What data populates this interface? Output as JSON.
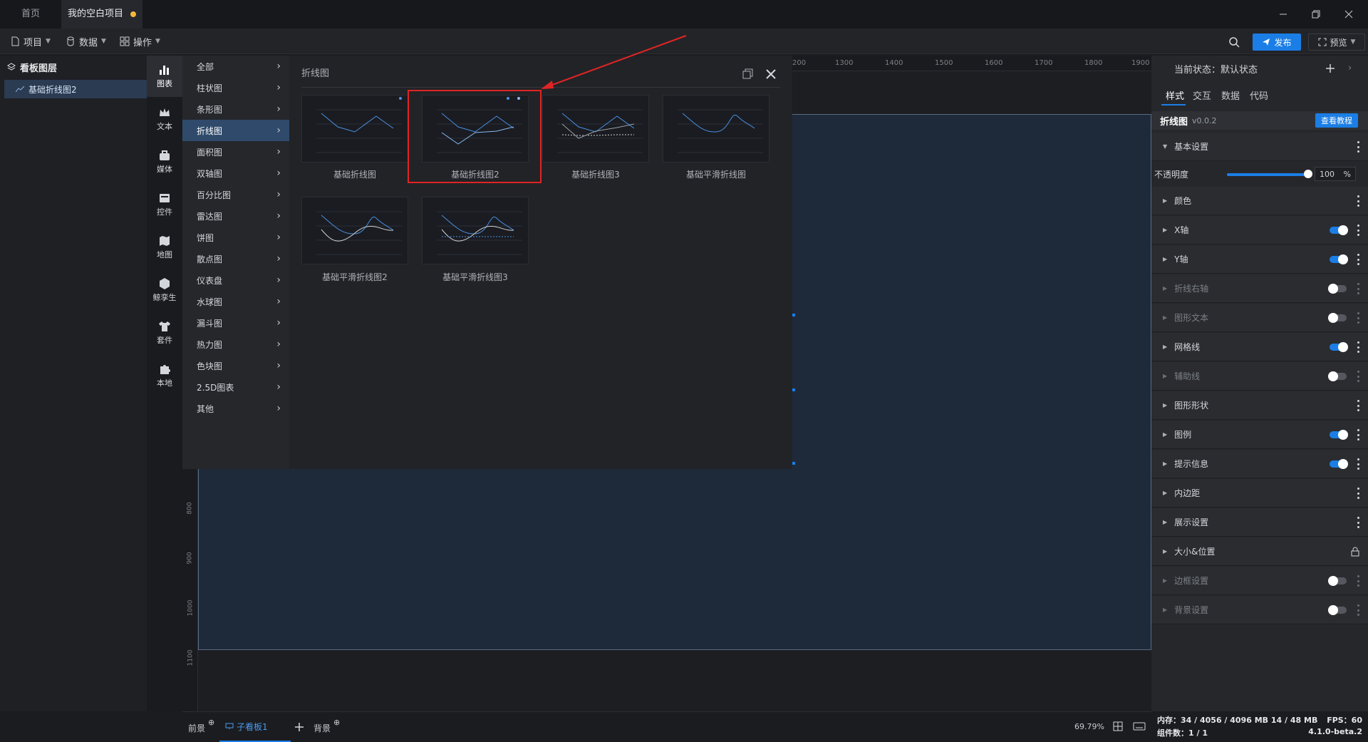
{
  "tabs": {
    "home": "首页",
    "project": "我的空白项目"
  },
  "menu": {
    "project": "项目",
    "data": "数据",
    "ops": "操作"
  },
  "toolbar": {
    "publish": "发布",
    "preview": "预览"
  },
  "layers": {
    "title": "看板图层",
    "item": "基础折线图2"
  },
  "categories": [
    "图表",
    "文本",
    "媒体",
    "控件",
    "地图",
    "鲸孪生",
    "套件",
    "本地"
  ],
  "types": [
    "全部",
    "柱状图",
    "条形图",
    "折线图",
    "面积图",
    "双轴图",
    "百分比图",
    "雷达图",
    "饼图",
    "散点图",
    "仪表盘",
    "水球图",
    "漏斗图",
    "热力图",
    "色块图",
    "2.5D图表",
    "其他"
  ],
  "popup": {
    "title": "折线图",
    "items": [
      "基础折线图",
      "基础折线图2",
      "基础折线图3",
      "基础平滑折线图",
      "基础平滑折线图2",
      "基础平滑折线图3"
    ]
  },
  "ruler": {
    "top": [
      "200",
      "1300",
      "1400",
      "1500",
      "1600",
      "1700",
      "1800",
      "1900"
    ],
    "left": [
      "800",
      "900",
      "1000",
      "1100"
    ]
  },
  "right": {
    "state_label": "当前状态：默认状态",
    "tabs": [
      "样式",
      "交互",
      "数据",
      "代码"
    ],
    "component": "折线图",
    "version": "v0.0.2",
    "tutorial": "查看教程",
    "sections": [
      {
        "label": "基本设置",
        "expanded": true,
        "enabled": true
      },
      {
        "label": "颜色",
        "enabled": true
      },
      {
        "label": "X轴",
        "toggle": "on",
        "enabled": true
      },
      {
        "label": "Y轴",
        "toggle": "on",
        "enabled": true
      },
      {
        "label": "折线右轴",
        "toggle": "off",
        "enabled": false
      },
      {
        "label": "图形文本",
        "toggle": "off",
        "enabled": false
      },
      {
        "label": "网格线",
        "toggle": "on",
        "enabled": true
      },
      {
        "label": "辅助线",
        "toggle": "off",
        "enabled": false
      },
      {
        "label": "图形形状",
        "enabled": true
      },
      {
        "label": "图例",
        "toggle": "on",
        "enabled": true
      },
      {
        "label": "提示信息",
        "toggle": "on",
        "enabled": true
      },
      {
        "label": "内边距",
        "enabled": true
      },
      {
        "label": "展示设置",
        "enabled": true
      },
      {
        "label": "大小&位置",
        "lock": true,
        "enabled": true
      },
      {
        "label": "边框设置",
        "toggle": "off",
        "enabled": false
      },
      {
        "label": "背景设置",
        "toggle": "off",
        "enabled": false
      }
    ],
    "opacity_label": "不透明度",
    "opacity_value": "100",
    "opacity_unit": "%"
  },
  "bottom": {
    "front": "前景",
    "board": "子看板1",
    "back": "背景",
    "zoom": "69.79%"
  },
  "status": {
    "memory": "内存：34 / 4056 / 4096 MB 14 / 48 MB",
    "fps": "FPS：60",
    "components": "组件数：1 / 1",
    "version": "4.1.0-beta.2"
  }
}
